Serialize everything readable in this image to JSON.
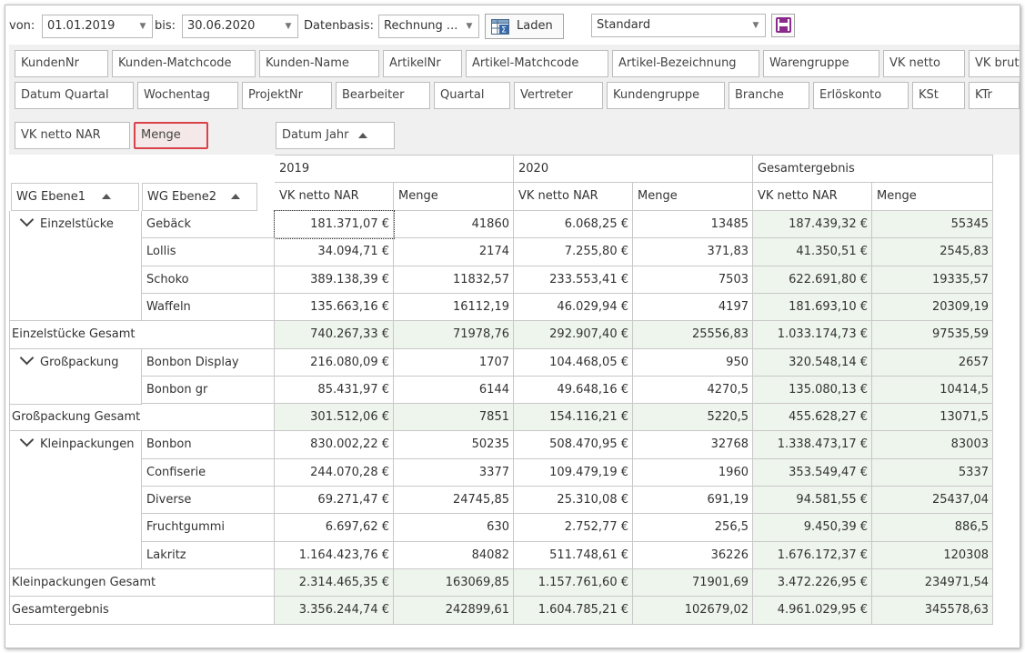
{
  "toolbar": {
    "von_label": "von:",
    "von_value": "01.01.2019",
    "bis_label": "bis:",
    "bis_value": "30.06.2020",
    "datenbasis_label": "Datenbasis:",
    "datenbasis_value": "Rechnung ...",
    "laden_label": "Laden",
    "layout_value": "Standard"
  },
  "field_list": {
    "row1": [
      "KundenNr",
      "Kunden-Matchcode",
      "Kunden-Name",
      "ArtikelNr",
      "Artikel-Matchcode",
      "Artikel-Bezeichnung",
      "Warengruppe",
      "VK netto",
      "VK brutto"
    ],
    "row2": [
      "Datum Quartal",
      "Wochentag",
      "ProjektNr",
      "Bearbeiter",
      "Quartal",
      "Vertreter",
      "Kundengruppe",
      "Branche",
      "Erlöskonto",
      "KSt",
      "KTr"
    ]
  },
  "data_fields": [
    "VK netto NAR",
    "Menge"
  ],
  "column_field": "Datum Jahr",
  "row_fields": [
    "WG Ebene1",
    "WG Ebene2"
  ],
  "years": [
    "2019",
    "2020",
    "Gesamtergebnis"
  ],
  "measures": [
    "VK netto NAR",
    "Menge"
  ],
  "groups": [
    {
      "name": "Einzelstücke",
      "rows": [
        {
          "name": "Gebäck",
          "v": [
            "181.371,07 €",
            "41860",
            "6.068,25 €",
            "13485",
            "187.439,32 €",
            "55345"
          ]
        },
        {
          "name": "Lollis",
          "v": [
            "34.094,71 €",
            "2174",
            "7.255,80 €",
            "371,83",
            "41.350,51 €",
            "2545,83"
          ]
        },
        {
          "name": "Schoko",
          "v": [
            "389.138,39 €",
            "11832,57",
            "233.553,41 €",
            "7503",
            "622.691,80 €",
            "19335,57"
          ]
        },
        {
          "name": "Waffeln",
          "v": [
            "135.663,16 €",
            "16112,19",
            "46.029,94 €",
            "4197",
            "181.693,10 €",
            "20309,19"
          ]
        }
      ],
      "total_label": "Einzelstücke Gesamt",
      "total": [
        "740.267,33 €",
        "71978,76",
        "292.907,40 €",
        "25556,83",
        "1.033.174,73 €",
        "97535,59"
      ]
    },
    {
      "name": "Großpackung",
      "rows": [
        {
          "name": "Bonbon Display",
          "v": [
            "216.080,09 €",
            "1707",
            "104.468,05 €",
            "950",
            "320.548,14 €",
            "2657"
          ]
        },
        {
          "name": "Bonbon gr",
          "v": [
            "85.431,97 €",
            "6144",
            "49.648,16 €",
            "4270,5",
            "135.080,13 €",
            "10414,5"
          ]
        }
      ],
      "total_label": "Großpackung Gesamt",
      "total": [
        "301.512,06 €",
        "7851",
        "154.116,21 €",
        "5220,5",
        "455.628,27 €",
        "13071,5"
      ]
    },
    {
      "name": "Kleinpackungen",
      "rows": [
        {
          "name": "Bonbon",
          "v": [
            "830.002,22 €",
            "50235",
            "508.470,95 €",
            "32768",
            "1.338.473,17 €",
            "83003"
          ]
        },
        {
          "name": "Confiserie",
          "v": [
            "244.070,28 €",
            "3377",
            "109.479,19 €",
            "1960",
            "353.549,47 €",
            "5337"
          ]
        },
        {
          "name": "Diverse",
          "v": [
            "69.271,47 €",
            "24745,85",
            "25.310,08 €",
            "691,19",
            "94.581,55 €",
            "25437,04"
          ]
        },
        {
          "name": "Fruchtgummi",
          "v": [
            "6.697,62 €",
            "630",
            "2.752,77 €",
            "256,5",
            "9.450,39 €",
            "886,5"
          ]
        },
        {
          "name": "Lakritz",
          "v": [
            "1.164.423,76 €",
            "84082",
            "511.748,61 €",
            "36226",
            "1.676.172,37 €",
            "120308"
          ]
        }
      ],
      "total_label": "Kleinpackungen Gesamt",
      "total": [
        "2.314.465,35 €",
        "163069,85",
        "1.157.761,60 €",
        "71901,69",
        "3.472.226,95 €",
        "234971,54"
      ]
    }
  ],
  "grand_total_label": "Gesamtergebnis",
  "grand_total": [
    "3.356.244,74 €",
    "242899,61",
    "1.604.785,21 €",
    "102679,02",
    "4.961.029,95 €",
    "345578,63"
  ]
}
